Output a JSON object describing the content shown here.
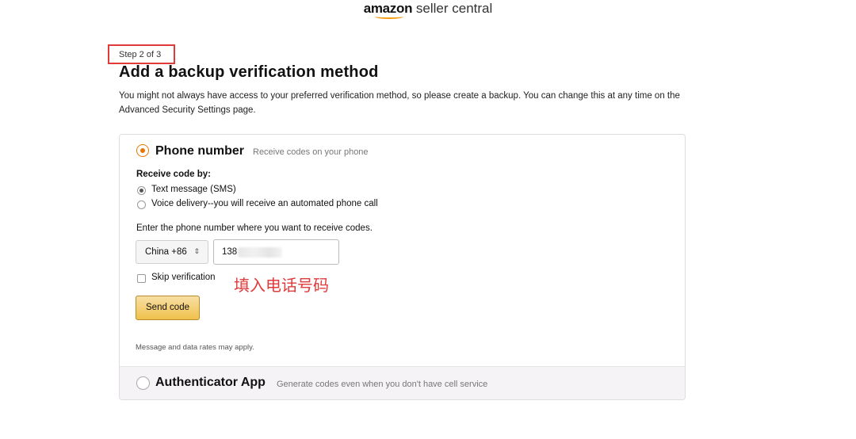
{
  "logo": {
    "brand": "amazon",
    "product": " seller central"
  },
  "step": {
    "label": "Step 2 of 3"
  },
  "title": "Add a backup verification method",
  "intro": "You might not always have access to your preferred verification method, so please create a backup. You can change this at any time on the Advanced Security Settings page.",
  "phone_option": {
    "title": "Phone number",
    "description": "Receive codes on your phone",
    "selected": true,
    "receive_by_label": "Receive code by:",
    "methods": [
      {
        "label": "Text message (SMS)",
        "selected": true
      },
      {
        "label": "Voice delivery--you will receive an automated phone call",
        "selected": false
      }
    ],
    "enter_phone_label": "Enter the phone number where you want to receive codes.",
    "country_select": {
      "value": "China +86",
      "arrow": "⇕"
    },
    "phone_input": {
      "value": "138"
    },
    "skip_label": "Skip verification",
    "annotation": "填入电话号码",
    "send_button": "Send code",
    "rates_note": "Message and data rates may apply."
  },
  "app_option": {
    "title": "Authenticator App",
    "description": "Generate codes even when you don't have cell service",
    "selected": false
  },
  "colors": {
    "accent": "#e77600",
    "annotation": "#e03a3a",
    "button": "#f0c14b"
  }
}
